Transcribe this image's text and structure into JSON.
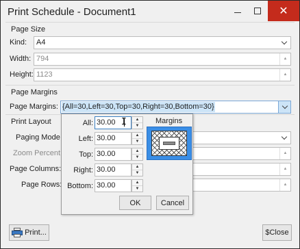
{
  "window": {
    "title": "Print Schedule - Document1"
  },
  "page_size": {
    "header": "Page Size",
    "kind_label": "Kind:",
    "kind_value": "A4",
    "width_label": "Width:",
    "width_value": "794",
    "height_label": "Height:",
    "height_value": "1123"
  },
  "page_margins": {
    "header": "Page Margins",
    "label": "Page Margins:",
    "value": "{All=30,Left=30,Top=30,Right=30,Bottom=30}"
  },
  "print_layout": {
    "header": "Print Layout",
    "paging_mode_label": "Paging Mode",
    "zoom_percent_label": "Zoom Percent",
    "page_columns_label": "Page Columns:",
    "page_rows_label": "Page Rows:"
  },
  "margins_popup": {
    "all_label": "All:",
    "all_value": "30.00",
    "left_label": "Left:",
    "left_value": "30.00",
    "top_label": "Top:",
    "top_value": "30.00",
    "right_label": "Right:",
    "right_value": "30.00",
    "bottom_label": "Bottom:",
    "bottom_value": "30.00",
    "preview_label": "Margins",
    "ok_label": "OK",
    "cancel_label": "Cancel"
  },
  "footer": {
    "print_label": "Print...",
    "close_label": "$Close"
  },
  "colors": {
    "accent": "#3a8ee6",
    "selection": "#cce4f7",
    "close_button": "#c42b1c"
  },
  "icons": [
    "minimize-icon",
    "maximize-icon",
    "close-icon",
    "chevron-down-icon",
    "spin-up-icon",
    "spin-down-icon",
    "printer-icon",
    "text-cursor-icon"
  ]
}
